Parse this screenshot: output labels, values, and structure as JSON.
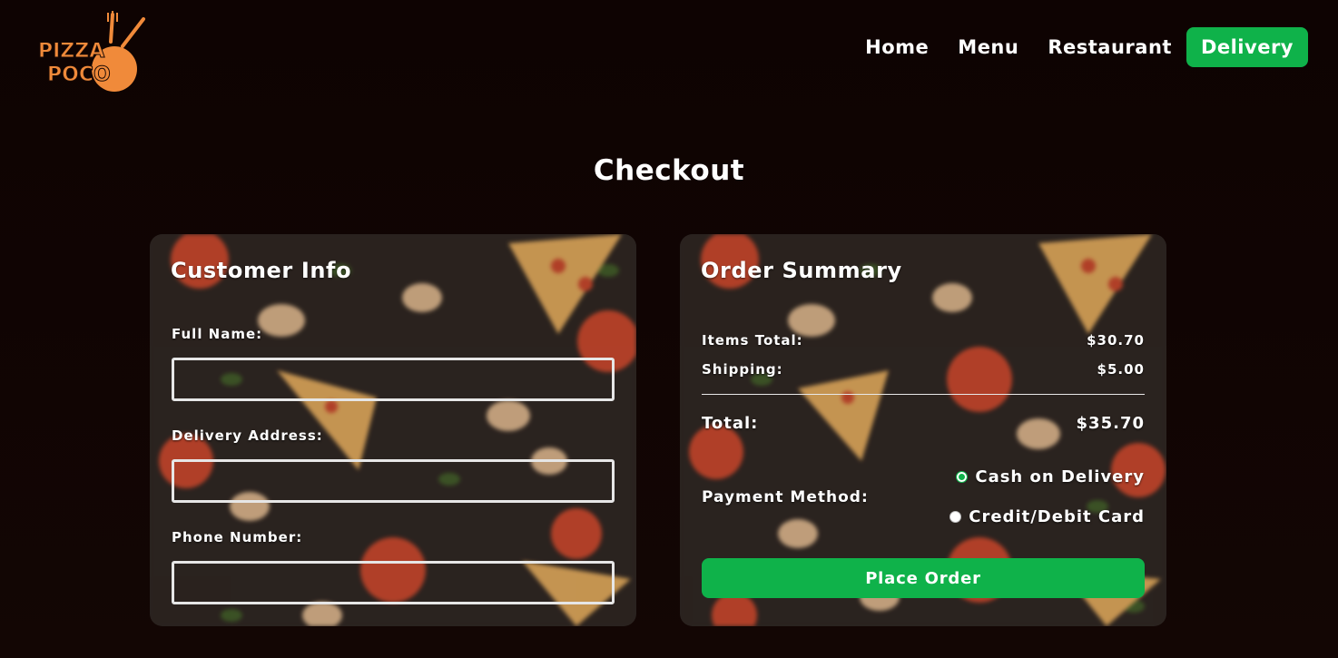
{
  "brand": {
    "logo_line1": "PIZZA",
    "logo_line2": "POCO"
  },
  "nav": [
    {
      "label": "Home",
      "active": false
    },
    {
      "label": "Menu",
      "active": false
    },
    {
      "label": "Restaurant",
      "active": false
    },
    {
      "label": "Delivery",
      "active": true
    }
  ],
  "colors": {
    "accent": "#0fb24a",
    "logo": "#f08a3a",
    "background": "#0e0302"
  },
  "page_title": "Checkout",
  "customer": {
    "title": "Customer Info",
    "fields": [
      {
        "label": "Full Name:",
        "value": ""
      },
      {
        "label": "Delivery Address:",
        "value": ""
      },
      {
        "label": "Phone Number:",
        "value": ""
      }
    ]
  },
  "summary": {
    "title": "Order Summary",
    "items_label": "Items Total:",
    "items_value": "$30.70",
    "shipping_label": "Shipping:",
    "shipping_value": "$5.00",
    "total_label": "Total:",
    "total_value": "$35.70",
    "payment_label": "Payment Method:",
    "payment_options": [
      {
        "label": "Cash on Delivery",
        "selected": true
      },
      {
        "label": "Credit/Debit Card",
        "selected": false
      }
    ],
    "place_order": "Place Order"
  }
}
